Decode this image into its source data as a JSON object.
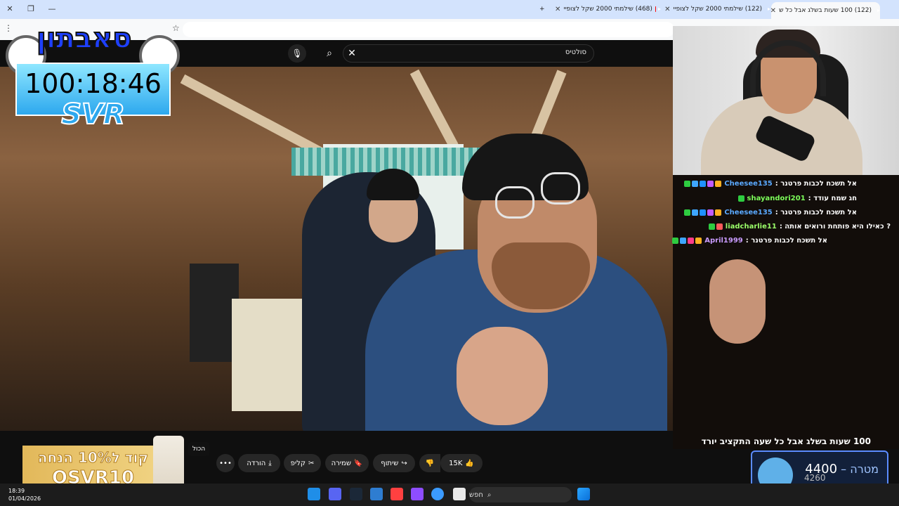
{
  "browser": {
    "tabs": [
      {
        "label": "(122) 100 שעות בשלג אבל כל ש"
      },
      {
        "label": "(122) שילמתי 2000 שקל לצופיי"
      },
      {
        "label": "(468) שילמתי 2000 שקל לצופיי"
      }
    ],
    "new_tab_label": "+"
  },
  "youtube": {
    "search_value": "סולטיס",
    "video_title": "100 שעות בשלג אבל כל שעה התקציב יורד",
    "actions": {
      "likes": "15K",
      "share": "שיתוף",
      "save": "שמירה",
      "clip": "קליפ",
      "download": "הורדה",
      "all": "הכול"
    }
  },
  "overlay": {
    "logo_text": "סאבתון",
    "timer": "100:18:46",
    "brand": "SVR",
    "promo_line1": "קוד ל10% הנחה",
    "promo_line2": "OSVR10",
    "goal_label": "מטרה",
    "goal_target": "4400",
    "goal_dash": "–",
    "goal_current": "4260"
  },
  "chat": [
    {
      "user": "Cheesee135",
      "color": "#5aa9ff",
      "text": "אל תשכח לכבות פרטנר :",
      "badges": [
        "#2ecc40",
        "#3ea6ff",
        "#1e90ff",
        "#c05cff",
        "#ffb020"
      ]
    },
    {
      "user": "shayandori201",
      "color": "#7dff5a",
      "text": "חג שמח עודד :",
      "badges": [
        "#2ecc40"
      ]
    },
    {
      "user": "Cheesee135",
      "color": "#5aa9ff",
      "text": "אל תשכח לכבות פרטנר :",
      "badges": [
        "#2ecc40",
        "#3ea6ff",
        "#1e90ff",
        "#c05cff",
        "#ffb020"
      ]
    },
    {
      "user": "liadcharlie11",
      "color": "#9bff6a",
      "text": "? כאילו היא פותחת ורואים אותה :",
      "badges": [
        "#2ecc40",
        "#ff5a5a"
      ]
    },
    {
      "user": "April1999",
      "color": "#c99bff",
      "text": "אל תשכח לכבות פרטנר :",
      "badges": [
        "#2ecc40",
        "#3ea6ff",
        "#ff3c8a",
        "#ffb020"
      ]
    }
  ],
  "taskbar": {
    "search_label": "חפש",
    "time": "18:39",
    "date": "01/04/2026"
  },
  "colors": {
    "youtube_bg": "#0f0f0f",
    "timer_box": "#2da8ee",
    "goal_border": "#5b8cff"
  }
}
